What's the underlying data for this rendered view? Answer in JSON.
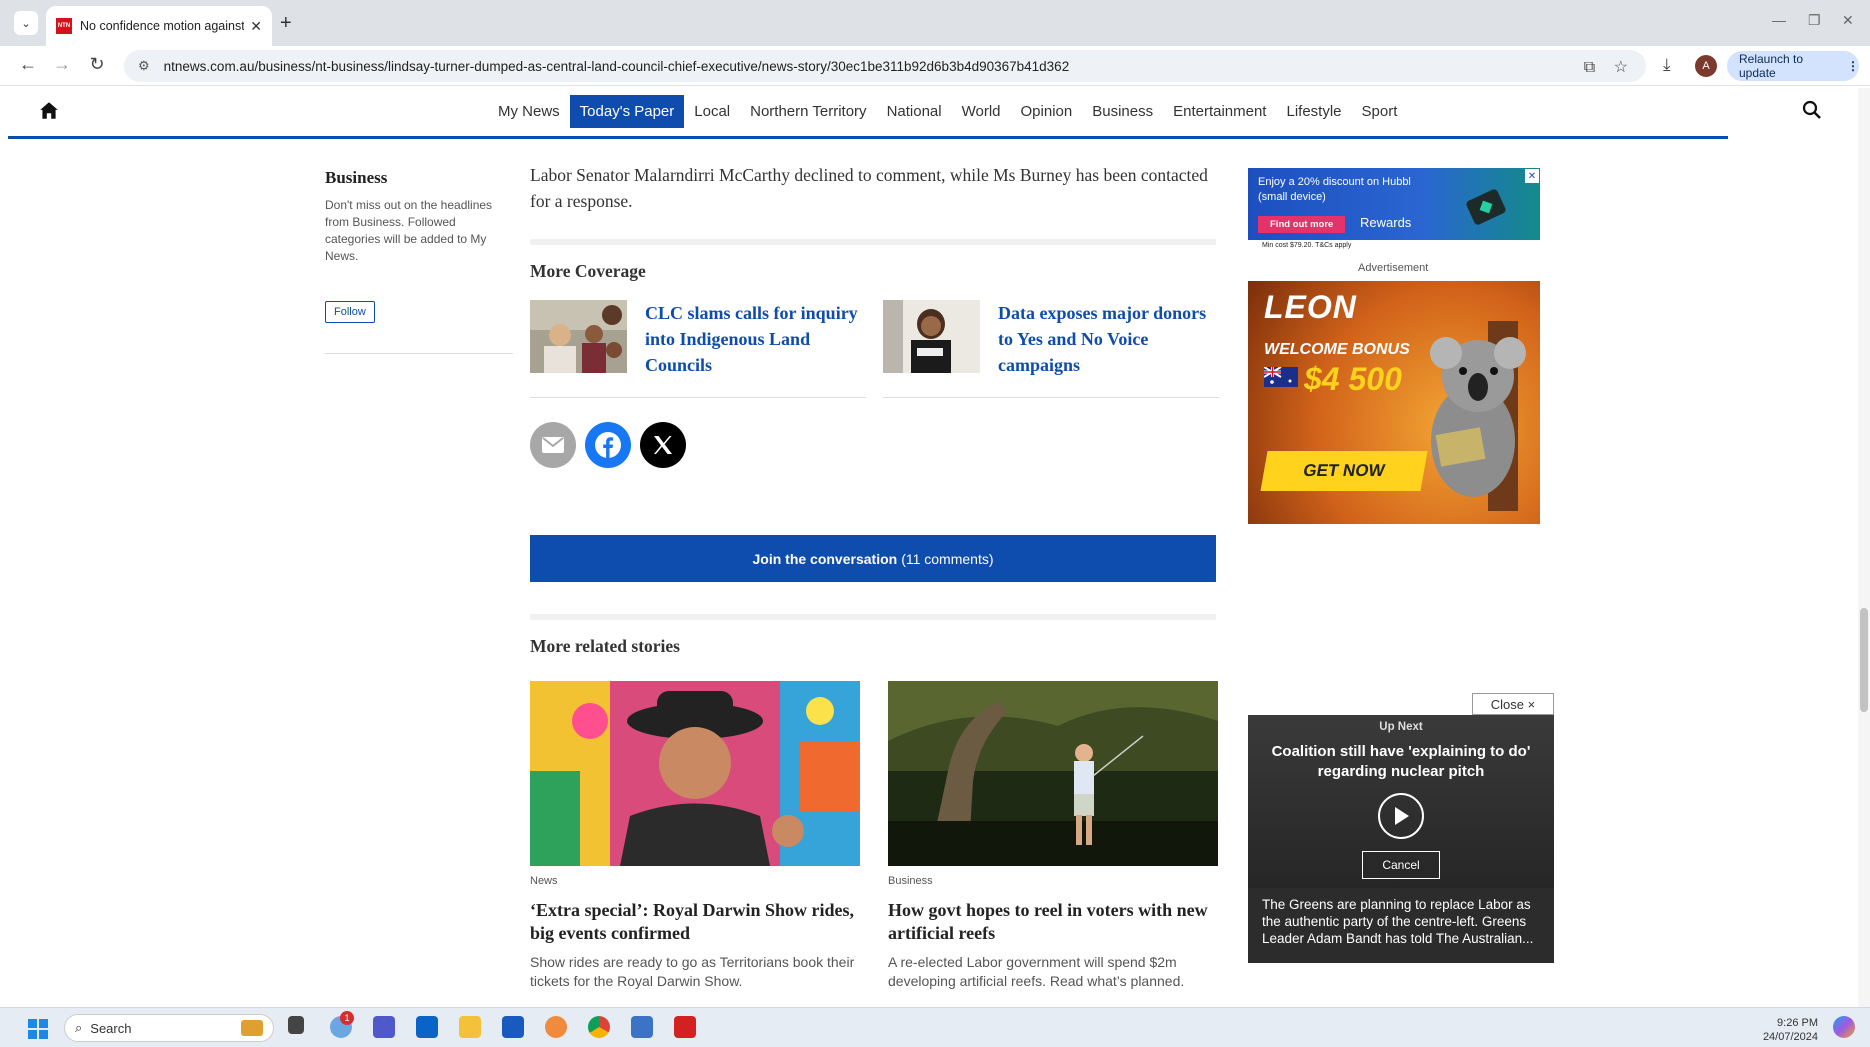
{
  "browser": {
    "tab_title": "No confidence motion against",
    "favicon_text": "NTN",
    "url": "ntnews.com.au/business/nt-business/lindsay-turner-dumped-as-central-land-council-chief-executive/news-story/30ec1be311b92d6b3b4d90367b41d362",
    "relaunch_label": "Relaunch to update",
    "profile_initial": "A"
  },
  "site_nav": {
    "items": [
      {
        "label": "My News",
        "active": false
      },
      {
        "label": "Today's Paper",
        "active": true
      },
      {
        "label": "Local",
        "active": false
      },
      {
        "label": "Northern Territory",
        "active": false
      },
      {
        "label": "National",
        "active": false
      },
      {
        "label": "World",
        "active": false
      },
      {
        "label": "Opinion",
        "active": false
      },
      {
        "label": "Business",
        "active": false
      },
      {
        "label": "Entertainment",
        "active": false
      },
      {
        "label": "Lifestyle",
        "active": false
      },
      {
        "label": "Sport",
        "active": false
      }
    ]
  },
  "follow": {
    "title": "Business",
    "description": "Don't miss out on the headlines from Business. Followed categories will be added to My News.",
    "button": "Follow"
  },
  "article": {
    "paragraph": "Labor Senator Malarndirri McCarthy declined to comment, while Ms Burney has been contacted for a response."
  },
  "more_coverage": {
    "title": "More Coverage",
    "items": [
      {
        "title": "CLC slams calls for inquiry into Indigenous Land Councils"
      },
      {
        "title": "Data exposes major donors to Yes and No Voice campaigns"
      }
    ]
  },
  "join": {
    "bold": "Join the conversation",
    "count": "(11 comments)"
  },
  "related": {
    "title": "More related stories",
    "items": [
      {
        "category": "News",
        "title": "‘Extra special’: Royal Darwin Show rides, big events confirmed",
        "desc": "Show rides are ready to go as Territorians book their tickets for the Royal Darwin Show."
      },
      {
        "category": "Business",
        "title": "How govt hopes to reel in voters with new artificial reefs",
        "desc": "A re-elected Labor government will spend $2m developing artificial reefs. Read what’s planned."
      }
    ]
  },
  "ads": {
    "hubbl_text": "Enjoy a 20% discount on Hubbl (small device)",
    "hubbl_btn": "Find out more",
    "hubbl_rewards": "Rewards",
    "hubbl_small": "Min cost $79.20. T&Cs apply",
    "advertisement_label": "Advertisement",
    "leon_brand": "LEON",
    "leon_welcome": "WELCOME BONUS",
    "leon_amount": "$4 500",
    "leon_cta": "GET NOW"
  },
  "video": {
    "close": "Close ×",
    "up_next": "Up Next",
    "title": "Coalition still have 'explaining to do' regarding nuclear pitch",
    "cancel": "Cancel",
    "desc": "The Greens are planning to replace Labor as the authentic party of the centre-left. Greens Leader Adam Bandt has told The Australian..."
  },
  "taskbar": {
    "search": "Search",
    "time": "9:26 PM",
    "date": "24/07/2024",
    "badge": "1"
  },
  "colors": {
    "brand_blue": "#0e4dad",
    "leon_yellow": "#ffd21e"
  }
}
